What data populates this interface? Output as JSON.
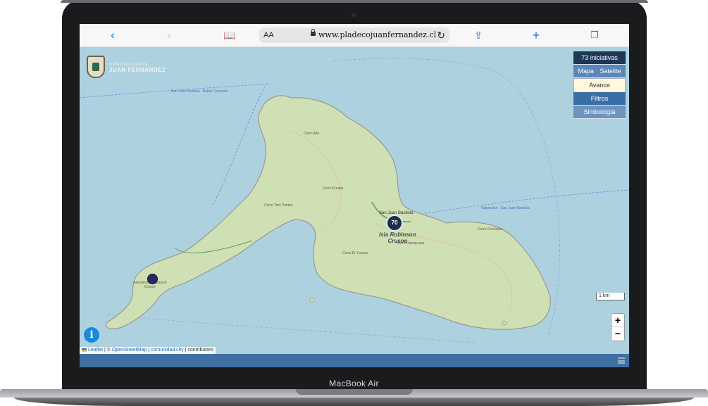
{
  "device": {
    "label": "MacBook Air"
  },
  "browser": {
    "text_size_label": "AA",
    "url": "www.pladecojuanfernandez.cl",
    "icons": [
      "back-icon",
      "forward-icon",
      "bookmarks-icon",
      "lock-icon",
      "reload-icon",
      "share-icon",
      "new-tab-icon",
      "tabs-icon"
    ]
  },
  "logo": {
    "small_text": "MUNICIPALIDAD DE",
    "name": "JUAN FERNANDEZ"
  },
  "panel": {
    "count_label": "73 iniciativas",
    "map_label": "Mapa",
    "satellite_label": "Satelite",
    "avance_label": "Avance",
    "filtros_label": "Filtros",
    "simbologia_label": "Simbología"
  },
  "map": {
    "island_name_1": "Isla Robinson",
    "island_name_2": "Crusoe",
    "town_label": "San Juan Bautista",
    "cluster_count": "70",
    "scale_label": "1 km",
    "zoom_in": "+",
    "zoom_out": "−",
    "info_label": "i",
    "routes": [
      "San Juan Bautista - Bahía Colorada",
      "Valparaíso - San Juan Bautista"
    ],
    "peaks": [
      "Cerro Alto",
      "Cerro Puntas",
      "Cerro Tres Puntas",
      "Cerro Centinela",
      "Cerro Damajuana",
      "Cerro El Yunque"
    ],
    "airport_label": "Aeródromo Robinson Crusoe"
  },
  "attribution": {
    "leaflet": "Leaflet",
    "sep1": " | © ",
    "osm": "OpenStreetMap",
    "sep2": " | ",
    "comunidad": "comunidad.city",
    "sep3": " | contributors"
  },
  "colors": {
    "panel_dark": "#1d3857",
    "panel_blue": "#3c6ea6",
    "statusbar": "#3f6fa3",
    "sea": "#aed1e0",
    "land": "#cfe0b4"
  }
}
